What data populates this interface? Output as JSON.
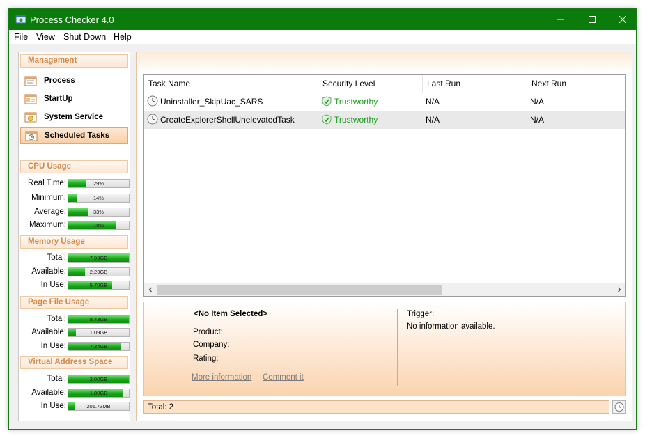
{
  "window": {
    "title": "Process Checker 4.0"
  },
  "menu": [
    "File",
    "View",
    "Shut Down",
    "Help"
  ],
  "management": {
    "header": "Management",
    "items": [
      {
        "label": "Process",
        "icon": "process-icon"
      },
      {
        "label": "StartUp",
        "icon": "startup-icon"
      },
      {
        "label": "System Service",
        "icon": "system-service-icon"
      },
      {
        "label": "Scheduled Tasks",
        "icon": "scheduled-tasks-icon",
        "active": true
      }
    ]
  },
  "cpu": {
    "header": "CPU Usage",
    "rows": [
      {
        "label": "Real Time:",
        "text": "29%",
        "fraction": 0.29
      },
      {
        "label": "Minimum:",
        "text": "14%",
        "fraction": 0.14
      },
      {
        "label": "Average:",
        "text": "33%",
        "fraction": 0.33
      },
      {
        "label": "Maximum:",
        "text": "78%",
        "fraction": 0.78
      }
    ]
  },
  "memory": {
    "header": "Memory Usage",
    "rows": [
      {
        "label": "Total:",
        "text": "7.93GB",
        "fraction": 1.0
      },
      {
        "label": "Available:",
        "text": "2.23GB",
        "fraction": 0.28
      },
      {
        "label": "In Use:",
        "text": "5.70GB",
        "fraction": 0.72
      }
    ]
  },
  "pagefile": {
    "header": "Page File Usage",
    "rows": [
      {
        "label": "Total:",
        "text": "8.43GB",
        "fraction": 1.0
      },
      {
        "label": "Available:",
        "text": "1.09GB",
        "fraction": 0.13
      },
      {
        "label": "In Use:",
        "text": "7.34GB",
        "fraction": 0.87
      }
    ]
  },
  "vas": {
    "header": "Virtual Address Space",
    "rows": [
      {
        "label": "Total:",
        "text": "2.00GB",
        "fraction": 1.0
      },
      {
        "label": "Available:",
        "text": "1.80GB",
        "fraction": 0.9
      },
      {
        "label": "In Use:",
        "text": "201.73MB",
        "fraction": 0.1
      }
    ]
  },
  "tasks": {
    "columns": [
      "Task Name",
      "Security Level",
      "Last Run",
      "Next Run"
    ],
    "rows": [
      {
        "name": "Uninstaller_SkipUac_SARS",
        "security": "Trustworthy",
        "last_run": "N/A",
        "next_run": "N/A"
      },
      {
        "name": "CreateExplorerShellUnelevatedTask",
        "security": "Trustworthy",
        "last_run": "N/A",
        "next_run": "N/A"
      }
    ]
  },
  "details": {
    "selected": "<No Item Selected>",
    "product_label": "Product:",
    "company_label": "Company:",
    "rating_label": "Rating:",
    "more_info_link": "More information",
    "comment_link": "Comment it",
    "trigger_label": "Trigger:",
    "trigger_value": "No information available."
  },
  "status": {
    "total": "Total: 2"
  },
  "colors": {
    "titlebar": "#0b7c0b",
    "accent": "#d08a4b",
    "trustworthy": "#1a9b1a",
    "bar_fill": "#19a619"
  }
}
